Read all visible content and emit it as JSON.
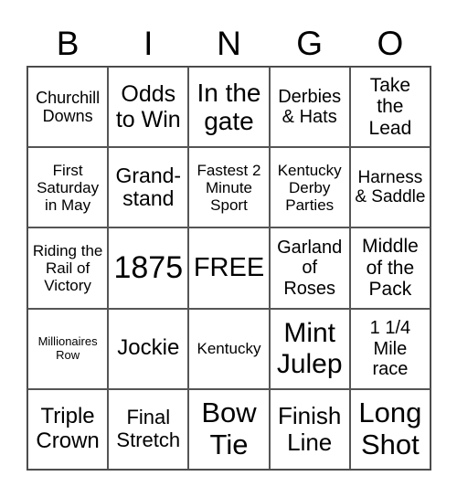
{
  "header": {
    "letters": [
      "B",
      "I",
      "N",
      "G",
      "O"
    ]
  },
  "cells": [
    [
      "Churchill Downs",
      "Odds to Win",
      "In the gate",
      "Derbies & Hats",
      "Take the Lead"
    ],
    [
      "First Saturday in May",
      "Grand-stand",
      "Fastest 2 Minute Sport",
      "Kentucky Derby Parties",
      "Harness & Saddle"
    ],
    [
      "Riding the Rail of Victory",
      "1875",
      "FREE",
      "Garland of Roses",
      "Middle of the Pack"
    ],
    [
      "Millionaires Row",
      "Jockie",
      "Kentucky",
      "Mint Julep",
      "1 1/4 Mile race"
    ],
    [
      "Triple Crown",
      "Final Stretch",
      "Bow Tie",
      "Finish Line",
      "Long Shot"
    ]
  ]
}
